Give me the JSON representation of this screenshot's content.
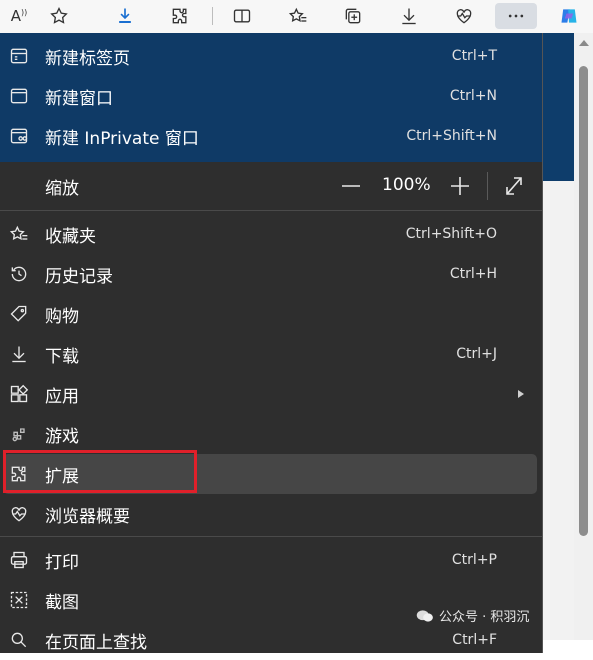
{
  "toolbar": {
    "read_aloud_label": "A",
    "icons": [
      "read-aloud-icon",
      "favorite-star-icon",
      "download-icon",
      "extensions-icon",
      "split-screen-icon",
      "favorites-icon",
      "collections-icon",
      "downloads-icon",
      "browser-essentials-icon",
      "more-icon",
      "copilot-icon"
    ]
  },
  "menu": {
    "new_tab": {
      "label": "新建标签页",
      "shortcut": "Ctrl+T"
    },
    "new_window": {
      "label": "新建窗口",
      "shortcut": "Ctrl+N"
    },
    "new_inprivate": {
      "label": "新建 InPrivate 窗口",
      "shortcut": "Ctrl+Shift+N"
    },
    "zoom": {
      "label": "缩放",
      "minus": "—",
      "value": "100%",
      "plus": "+"
    },
    "favorites": {
      "label": "收藏夹",
      "shortcut": "Ctrl+Shift+O"
    },
    "history": {
      "label": "历史记录",
      "shortcut": "Ctrl+H"
    },
    "shopping": {
      "label": "购物"
    },
    "downloads": {
      "label": "下载",
      "shortcut": "Ctrl+J"
    },
    "apps": {
      "label": "应用"
    },
    "games": {
      "label": "游戏"
    },
    "extensions": {
      "label": "扩展"
    },
    "essentials": {
      "label": "浏览器概要"
    },
    "print": {
      "label": "打印",
      "shortcut": "Ctrl+P"
    },
    "screenshot": {
      "label": "截图"
    },
    "find": {
      "label": "在页面上查找",
      "shortcut": "Ctrl+F"
    }
  },
  "watermark": {
    "text": "公众号 · 积羽沉"
  },
  "colors": {
    "menu_bg": "#2e2e2e",
    "menu_top_bg": "#0f3a66",
    "highlight": "#464646",
    "red_box": "#e0202a"
  }
}
